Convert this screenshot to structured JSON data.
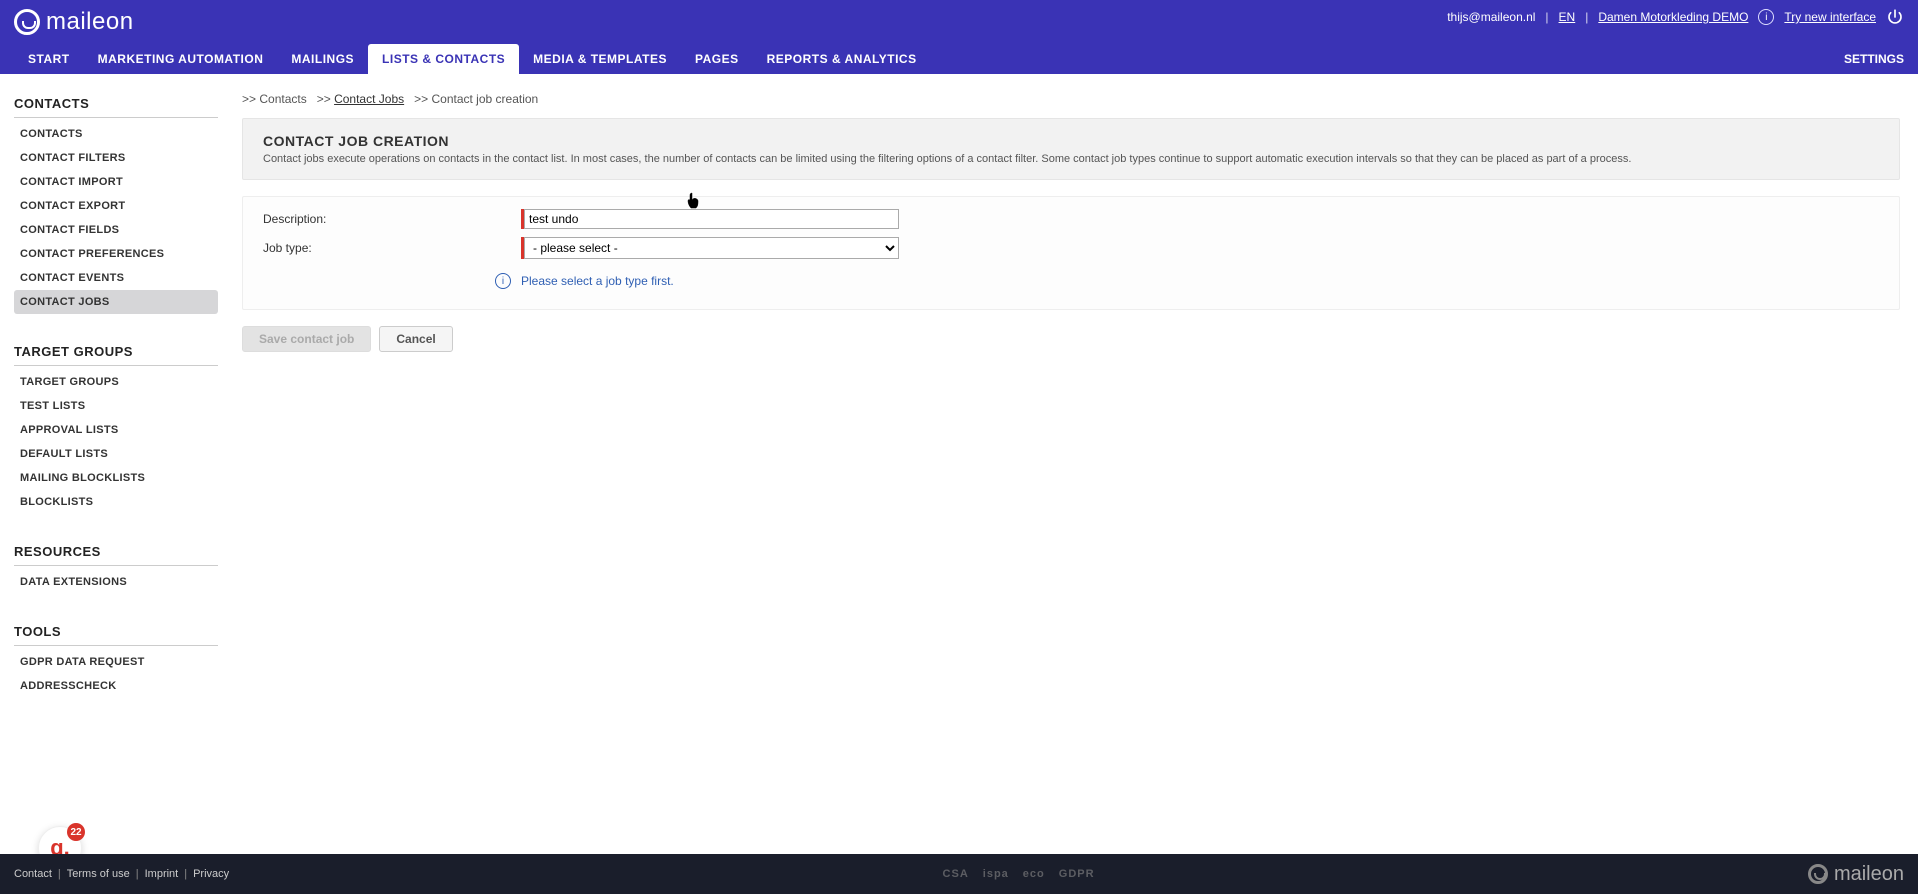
{
  "brand": "maileon",
  "header": {
    "user_email": "thijs@maileon.nl",
    "lang": "EN",
    "account": "Damen Motorkleding DEMO",
    "try_link": "Try new interface"
  },
  "nav": {
    "items": [
      "START",
      "MARKETING AUTOMATION",
      "MAILINGS",
      "LISTS & CONTACTS",
      "MEDIA & TEMPLATES",
      "PAGES",
      "REPORTS & ANALYTICS"
    ],
    "settings": "SETTINGS",
    "active_index": 3
  },
  "breadcrumb": {
    "c1": "Contacts",
    "c2": "Contact Jobs",
    "c3": "Contact job creation"
  },
  "sidebar": {
    "g1_title": "CONTACTS",
    "g1_items": [
      "CONTACTS",
      "CONTACT FILTERS",
      "CONTACT IMPORT",
      "CONTACT EXPORT",
      "CONTACT FIELDS",
      "CONTACT PREFERENCES",
      "CONTACT EVENTS",
      "CONTACT JOBS"
    ],
    "g1_active": 7,
    "g2_title": "TARGET GROUPS",
    "g2_items": [
      "TARGET GROUPS",
      "TEST LISTS",
      "APPROVAL LISTS",
      "DEFAULT LISTS",
      "MAILING BLOCKLISTS",
      "BLOCKLISTS"
    ],
    "g3_title": "RESOURCES",
    "g3_items": [
      "DATA EXTENSIONS"
    ],
    "g4_title": "TOOLS",
    "g4_items": [
      "GDPR DATA REQUEST",
      "ADDRESSCHECK"
    ]
  },
  "panel": {
    "title": "CONTACT JOB CREATION",
    "desc": "Contact jobs execute operations on contacts in the contact list. In most cases, the number of contacts can be limited using the filtering options of a contact filter. Some contact job types continue to support automatic execution intervals so that they can be placed as part of a process."
  },
  "form": {
    "desc_label": "Description:",
    "desc_value": "test undo",
    "jobtype_label": "Job type:",
    "jobtype_selected": "- please select -",
    "hint": "Please select a job type first."
  },
  "buttons": {
    "save": "Save contact job",
    "cancel": "Cancel"
  },
  "badge": {
    "letter": "g.",
    "count": "22"
  },
  "footer": {
    "links": [
      "Contact",
      "Terms of use",
      "Imprint",
      "Privacy"
    ],
    "certs": [
      "CSA",
      "ispa",
      "eco",
      "GDPR"
    ]
  }
}
